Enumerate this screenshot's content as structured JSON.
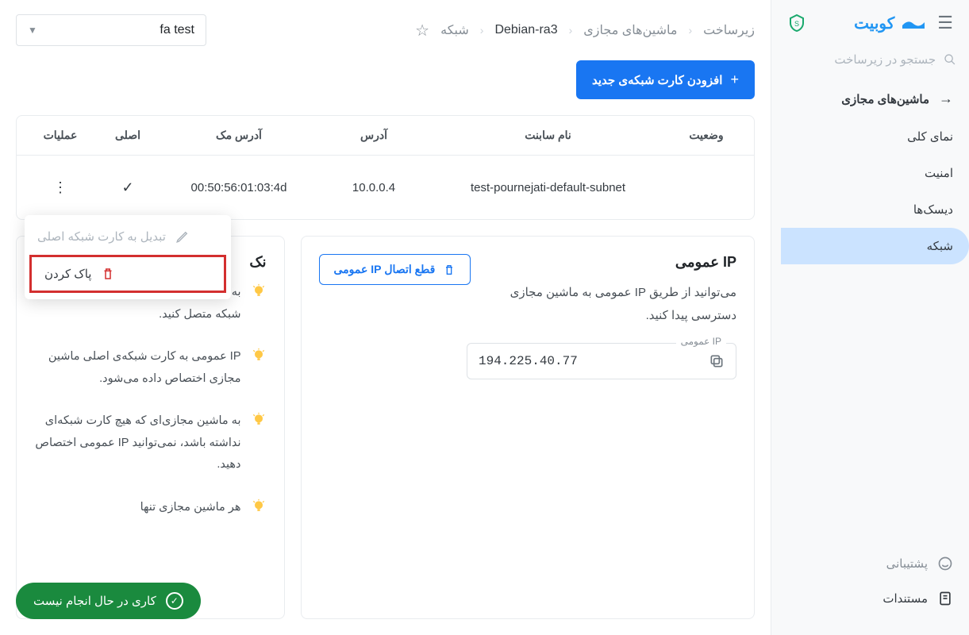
{
  "brand": {
    "name": "کوبیت"
  },
  "sidebar": {
    "search_placeholder": "جستجو در زیرساخت",
    "group_title": "ماشین‌های مجازی",
    "items": [
      {
        "label": "نمای کلی"
      },
      {
        "label": "امنیت"
      },
      {
        "label": "دیسک‌ها"
      },
      {
        "label": "شبکه"
      }
    ],
    "footer": {
      "support": "پشتیبانی",
      "docs": "مستندات"
    }
  },
  "breadcrumbs": {
    "root": "زیرساخت",
    "group": "ماشین‌های مجازی",
    "item": "Debian-ra3",
    "page": "شبکه"
  },
  "project_selector": {
    "value": "fa test"
  },
  "actions": {
    "add_card": "افزودن کارت شبکه‌ی جدید",
    "disconnect_ip": "قطع اتصال IP عمومی"
  },
  "table": {
    "headers": {
      "status": "وضعیت",
      "subnet": "نام سابنت",
      "address": "آدرس",
      "mac": "آدرس مک",
      "primary": "اصلی",
      "ops": "عملیات"
    },
    "row": {
      "subnet": "test-pournejati-default-subnet",
      "address": "10.0.0.4",
      "mac": "00:50:56:01:03:4d",
      "primary_check": "✓"
    }
  },
  "action_menu": {
    "make_primary": "تبدیل به کارت شبکه اصلی",
    "delete": "پاک کردن"
  },
  "ip_card": {
    "title": "IP عمومی",
    "desc": "می‌توانید از طریق IP عمومی به ماشین مجازی دسترسی پیدا کنید.",
    "field_label": "IP عمومی",
    "value": "194.225.40.77"
  },
  "tips": {
    "title": "نک",
    "items": [
      "به یک ماشین مجازی، می‌توانید چند کارت شبکه متصل کنید.",
      "IP عمومی به کارت شبکه‌ی اصلی ماشین مجازی اختصاص داده می‌شود.",
      "به ماشین مجازی‌ای که هیچ کارت شبکه‌ای نداشته باشد، نمی‌توانید IP عمومی اختصاص دهید.",
      "هر ماشین مجازی تنها"
    ]
  },
  "status_pill": {
    "text": "کاری در حال انجام نیست"
  }
}
